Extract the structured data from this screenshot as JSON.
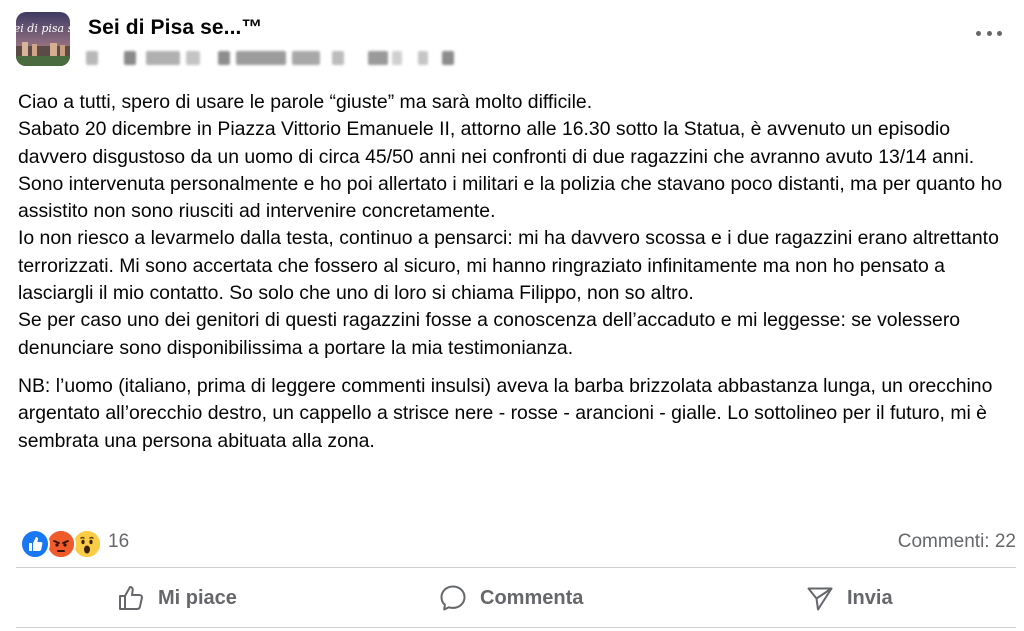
{
  "post": {
    "group_name": "Sei di Pisa se...™",
    "avatar_text": "Sei di pisa se",
    "paragraphs": [
      "Ciao a tutti, spero di usare le parole “giuste” ma sarà molto difficile.",
      "Sabato 20 dicembre in Piazza Vittorio Emanuele II, attorno alle 16.30 sotto la Statua, è avvenuto un episodio davvero disgustoso da un uomo di circa 45/50 anni nei confronti di due ragazzini che avranno avuto 13/14 anni.",
      "Sono intervenuta personalmente e ho poi allertato i militari e la polizia che stavano poco distanti, ma per quanto ho assistito non sono riusciti ad intervenire concretamente.",
      "Io non riesco a levarmelo dalla testa, continuo a pensarci: mi ha davvero scossa e i due ragazzini erano altrettanto terrorizzati. Mi sono accertata che fossero al sicuro, mi hanno ringraziato infinitamente ma non ho pensato a lasciargli il mio contatto. So solo che uno di loro si chiama Filippo, non so altro.",
      "Se per caso uno dei genitori di questi ragazzini fosse a conoscenza dell’accaduto e mi leggesse: se volessero denunciare sono disponibilissima a portare la mia testimonianza."
    ],
    "note": "NB: l’uomo (italiano, prima di leggere commenti insulsi) aveva la barba brizzolata abbastanza lunga, un orecchino argentato all’orecchio destro, un cappello a strisce nere - rosse - arancioni - gialle. Lo sottolineo per il futuro, mi è sembrata una persona abituata alla zona."
  },
  "stats": {
    "reactions": [
      "like-reaction-icon",
      "angry-reaction-icon",
      "wow-reaction-icon"
    ],
    "reaction_count": "16",
    "comments_label": "Commenti: 22"
  },
  "actions": {
    "like_label": "Mi piace",
    "comment_label": "Commenta",
    "share_label": "Invia"
  },
  "colors": {
    "text": "#050505",
    "secondary_text": "#65676b",
    "divider": "#ced0d4",
    "like_blue": "#1877f2",
    "angry_orange": "#f05b2c",
    "wow_yellow": "#fbcd46"
  }
}
